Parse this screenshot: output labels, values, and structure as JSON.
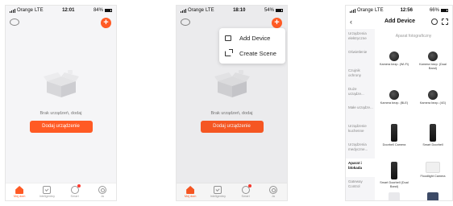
{
  "screen1": {
    "status": {
      "carrier": "Orange",
      "network": "LTE",
      "time": "12:01",
      "battery": "84%"
    },
    "empty_text": "Brak urządzeń, dodaj",
    "add_button": "Dodaj urządzenie",
    "tabs": [
      {
        "label": "Mój dom",
        "icon": "home-icon",
        "active": true
      },
      {
        "label": "Inteligentny",
        "icon": "smart-icon",
        "active": false
      },
      {
        "label": "Smart",
        "icon": "mall-icon",
        "active": false
      },
      {
        "label": "Ja",
        "icon": "profile-icon",
        "active": false
      }
    ]
  },
  "screen2": {
    "status": {
      "carrier": "Orange",
      "network": "LTE",
      "time": "18:10",
      "battery": "54%"
    },
    "menu": [
      {
        "label": "Add Device",
        "icon": "add-device-icon"
      },
      {
        "label": "Create Scene",
        "icon": "create-scene-icon"
      }
    ],
    "empty_text": "Brak urządzeń, dodaj",
    "add_button": "Dodaj urządzenie",
    "tabs": [
      {
        "label": "Mój dom",
        "icon": "home-icon",
        "active": true
      },
      {
        "label": "Inteligentny",
        "icon": "smart-icon",
        "active": false
      },
      {
        "label": "Smart",
        "icon": "mall-icon",
        "active": false
      },
      {
        "label": "Ja",
        "icon": "profile-icon",
        "active": false
      }
    ]
  },
  "screen3": {
    "status": {
      "carrier": "Orange",
      "network": "LTE",
      "time": "12:56",
      "battery": "66%"
    },
    "title": "Add Device",
    "subtitle": "Aparat fotograficzny",
    "categories": [
      "Urządzenia elektryczne",
      "Oświetlenie",
      "Czujnik ochrony",
      "Duże urządze...",
      "Małe urządze...",
      "Urządzenie kuchenne",
      "Urządzenia medyczne...",
      "Aparat i blokada",
      "Gateway Control"
    ],
    "active_category": "Aparat i blokada",
    "devices": [
      {
        "label": "Kamera bezp. (Wi-Fi)",
        "image": "camera-dome"
      },
      {
        "label": "Kamera bezp. (Dual Band)",
        "image": "camera-dome"
      },
      {
        "label": "Kamera bezp. (BLE)",
        "image": "camera-dome"
      },
      {
        "label": "Kamera bezp. (4G)",
        "image": "camera-dome"
      },
      {
        "label": "Doorbell Camera",
        "image": "doorbell"
      },
      {
        "label": "Smart Doorbell",
        "image": "doorbell"
      },
      {
        "label": "Smart Doorbell (Dual Band)",
        "image": "doorbell"
      },
      {
        "label": "Floodlight Camera",
        "image": "floodlight"
      }
    ]
  },
  "colors": {
    "accent": "#ff5a24",
    "background": "#f5f5f7"
  }
}
